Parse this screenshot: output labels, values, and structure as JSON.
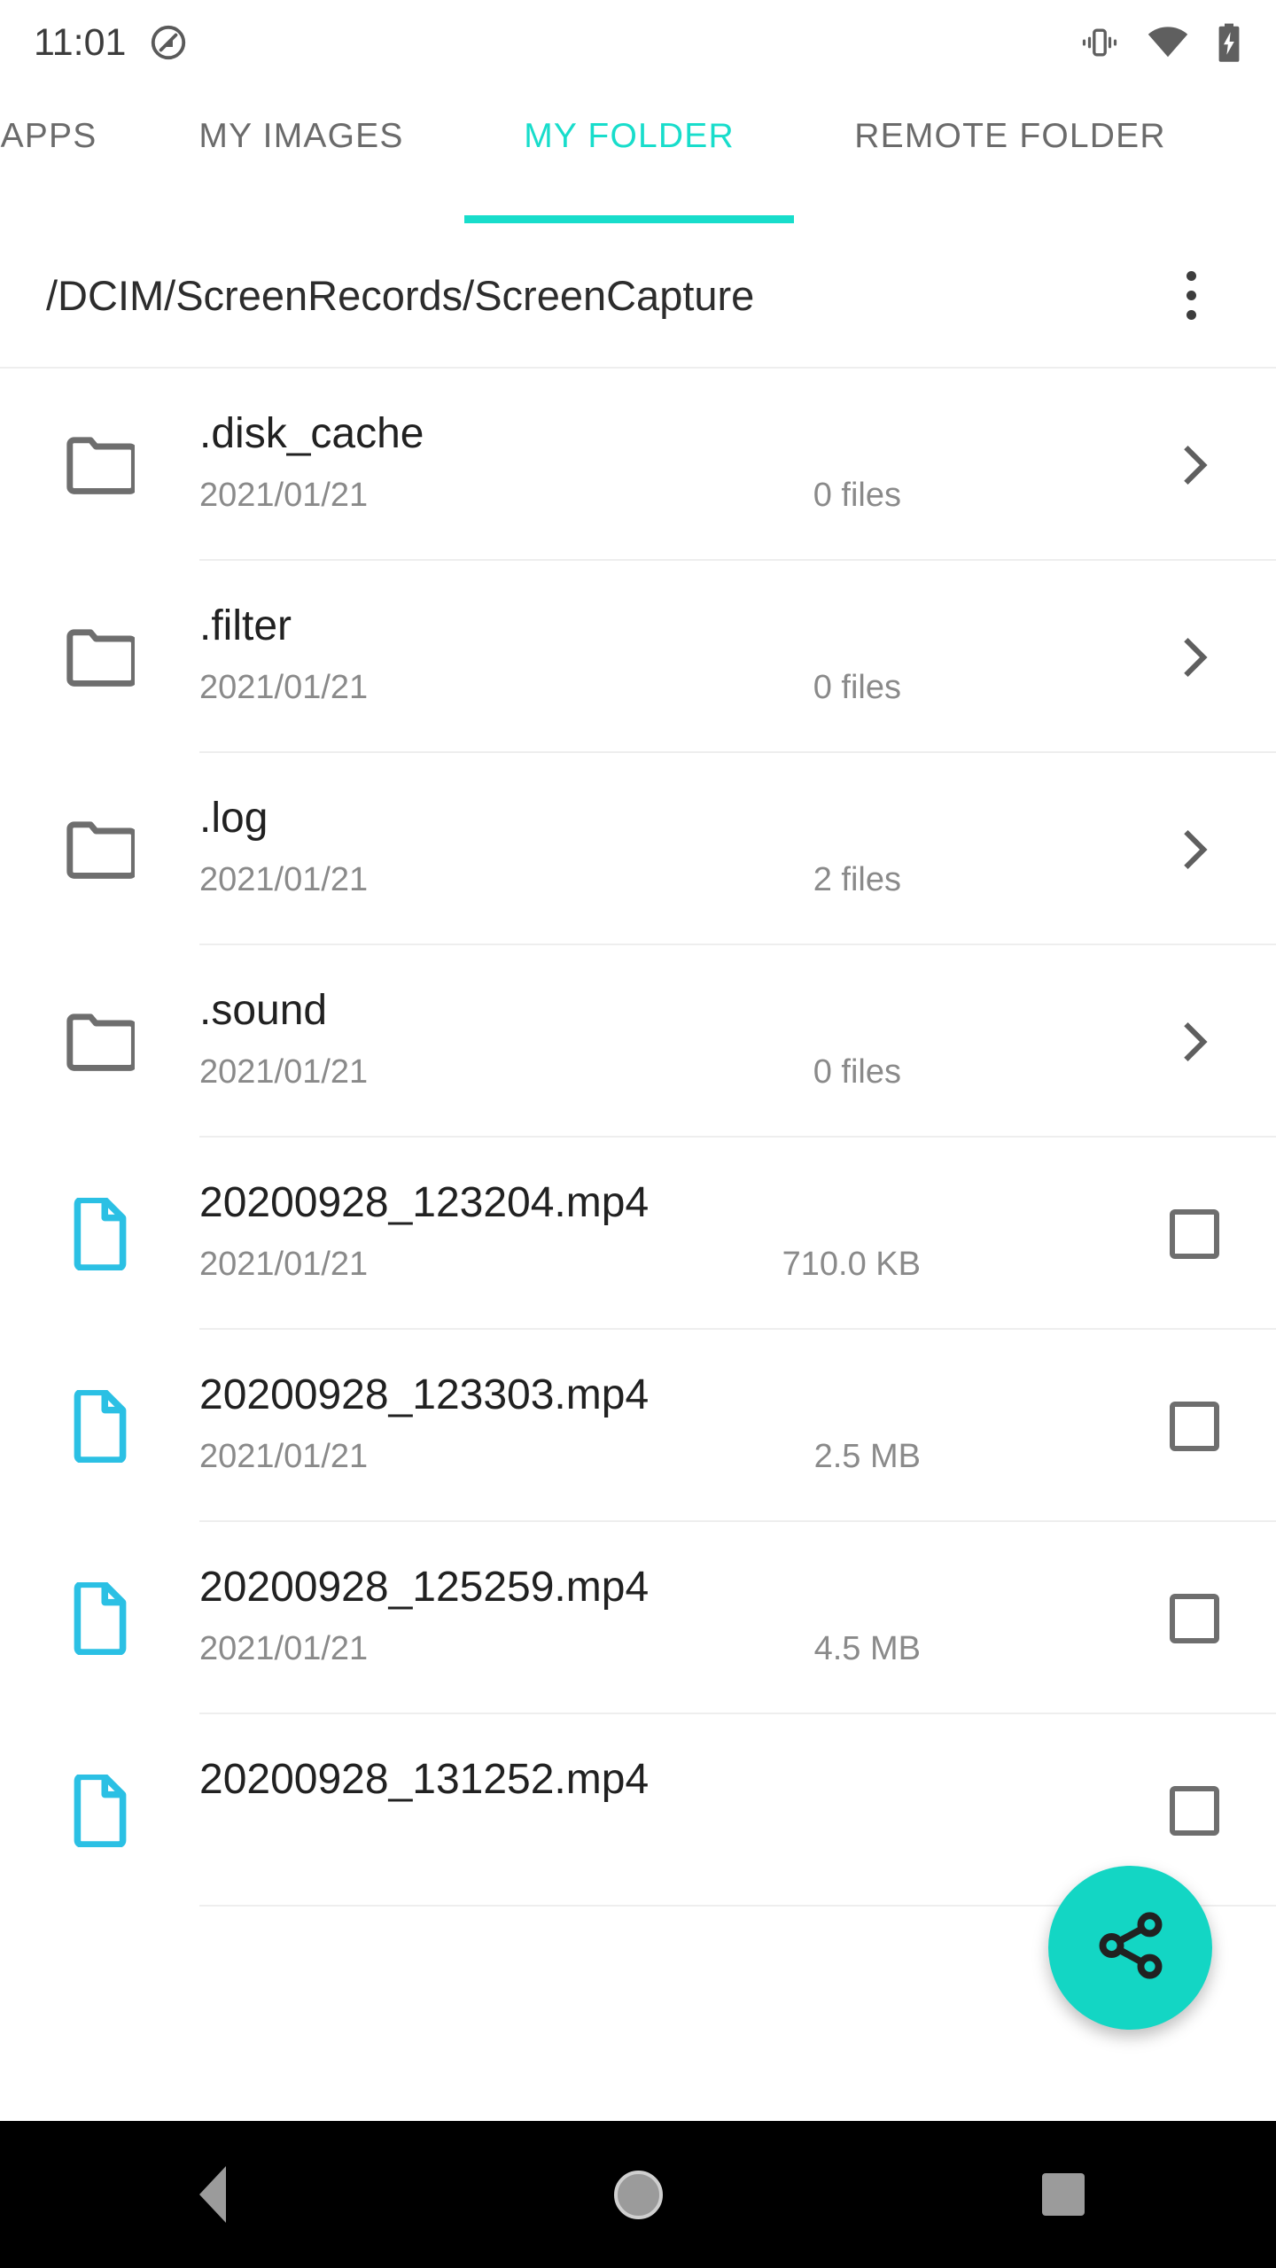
{
  "status_bar": {
    "clock": "11:01",
    "icons": [
      "do-not-disturb-icon",
      "vibrate-icon",
      "wifi-icon",
      "battery-charging-icon"
    ]
  },
  "tabs": [
    {
      "label": "APPS",
      "active": false
    },
    {
      "label": "MY IMAGES",
      "active": false
    },
    {
      "label": "MY FOLDER",
      "active": true
    },
    {
      "label": "REMOTE FOLDER",
      "active": false
    }
  ],
  "path_bar": {
    "path": "/DCIM/ScreenRecords/ScreenCapture",
    "overflow_label": "more-options"
  },
  "colors": {
    "accent_teal": "#18ddcb",
    "fab_teal": "#13d6c4",
    "file_icon_blue": "#2bc0e4",
    "folder_icon_gray": "#6e6e6e",
    "primary_text": "#212121",
    "secondary_text": "#8a8a8a",
    "divider": "#eeeeee",
    "navbar_bg": "#000000"
  },
  "list": [
    {
      "type": "folder",
      "name": ".disk_cache",
      "date": "2021/01/21",
      "meta": "0 files"
    },
    {
      "type": "folder",
      "name": ".filter",
      "date": "2021/01/21",
      "meta": "0 files"
    },
    {
      "type": "folder",
      "name": ".log",
      "date": "2021/01/21",
      "meta": "2 files"
    },
    {
      "type": "folder",
      "name": ".sound",
      "date": "2021/01/21",
      "meta": "0 files"
    },
    {
      "type": "file",
      "name": "20200928_123204.mp4",
      "date": "2021/01/21",
      "meta": "710.0 KB",
      "checked": false
    },
    {
      "type": "file",
      "name": "20200928_123303.mp4",
      "date": "2021/01/21",
      "meta": "2.5 MB",
      "checked": false
    },
    {
      "type": "file",
      "name": "20200928_125259.mp4",
      "date": "2021/01/21",
      "meta": "4.5 MB",
      "checked": false
    },
    {
      "type": "file",
      "name": "20200928_131252.mp4",
      "date": "",
      "meta": "",
      "checked": false
    }
  ],
  "fab": {
    "icon": "share-icon",
    "label": "Share"
  },
  "nav_bar": {
    "back_label": "Back",
    "home_label": "Home",
    "recents_label": "Recents"
  }
}
